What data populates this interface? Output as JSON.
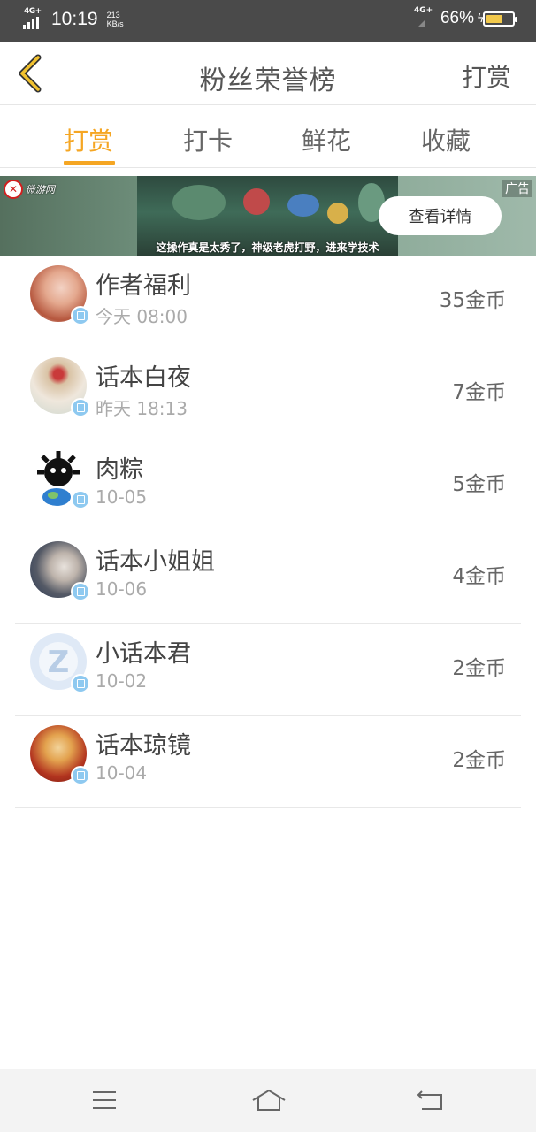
{
  "status_bar": {
    "network_left": "4G+",
    "time": "10:19",
    "speed_value": "213",
    "speed_unit": "KB/s",
    "network_right": "4G+",
    "battery_percent": "66%",
    "battery_level": 0.66
  },
  "navbar": {
    "back_icon": "chevron-left-icon",
    "title": "粉丝荣誉榜",
    "action_label": "打赏"
  },
  "tabs": [
    {
      "label": "打赏",
      "active": true
    },
    {
      "label": "打卡",
      "active": false
    },
    {
      "label": "鲜花",
      "active": false
    },
    {
      "label": "收藏",
      "active": false
    }
  ],
  "ad": {
    "brand": "微游网",
    "tag": "广告",
    "caption": "这操作真是太秀了，神级老虎打野，进来学技术",
    "button_label": "查看详情"
  },
  "fans": [
    {
      "name": "作者福利",
      "date": "今天 08:00",
      "coins": "35金币"
    },
    {
      "name": "话本白夜",
      "date": "昨天 18:13",
      "coins": "7金币"
    },
    {
      "name": "肉粽",
      "date": "10-05",
      "coins": "5金币"
    },
    {
      "name": "话本小姐姐",
      "date": "10-06",
      "coins": "4金币"
    },
    {
      "name": "小话本君",
      "date": "10-02",
      "coins": "2金币"
    },
    {
      "name": "话本琼镜",
      "date": "10-04",
      "coins": "2金币"
    }
  ],
  "colors": {
    "accent": "#f5a623",
    "badge": "#8ec9f0",
    "status_bar": "#4a4a4a"
  },
  "system_nav": [
    "menu-icon",
    "home-icon",
    "back-icon"
  ]
}
